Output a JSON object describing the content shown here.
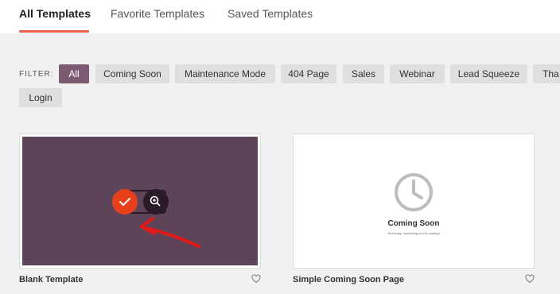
{
  "tabs": [
    {
      "label": "All Templates",
      "active": true
    },
    {
      "label": "Favorite Templates",
      "active": false
    },
    {
      "label": "Saved Templates",
      "active": false
    }
  ],
  "filter": {
    "label": "FILTER:",
    "chips": [
      "All",
      "Coming Soon",
      "Maintenance Mode",
      "404 Page",
      "Sales",
      "Webinar",
      "Lead Squeeze",
      "Tha",
      "Login"
    ],
    "active": "All"
  },
  "cards": [
    {
      "title": "Blank Template",
      "preview_color": "#5e4458",
      "select_icon": "check-icon",
      "preview_icon": "zoom-in-icon",
      "annotation": "red-arrow"
    },
    {
      "title": "Simple Coming Soon Page",
      "preview_heading": "Coming Soon",
      "preview_subtext": "Get ready, something cool is coming!",
      "preview_icon": "clock-icon"
    }
  ],
  "colors": {
    "accent": "#e8604c",
    "chip_active": "#7c5b72",
    "select_button": "#e8401a",
    "preview_button": "#2b1a28"
  }
}
